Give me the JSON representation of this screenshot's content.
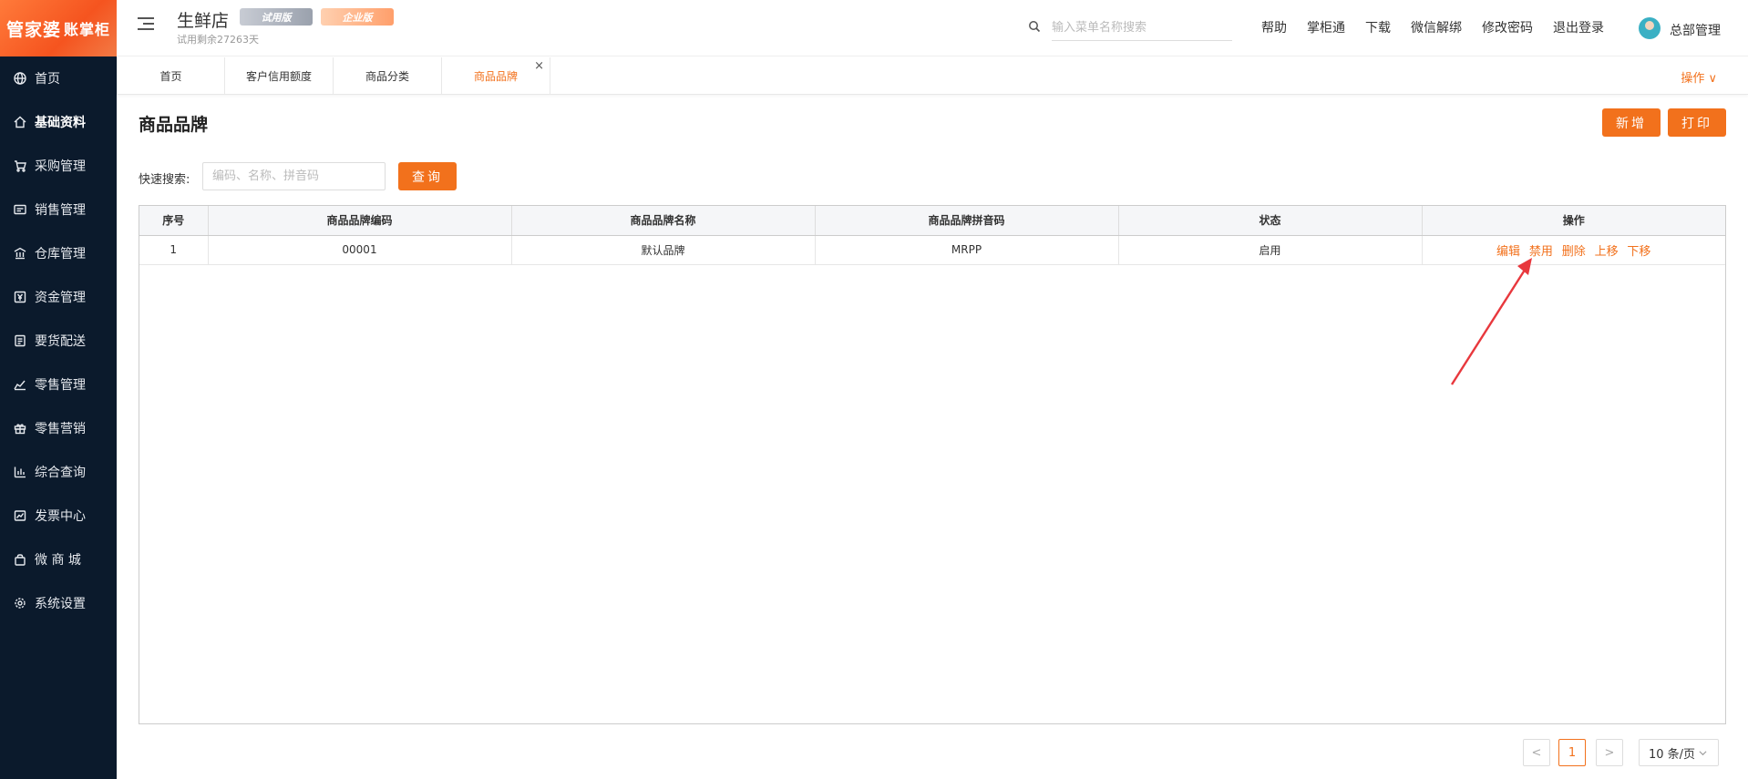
{
  "app": {
    "logo_text_1": "管家婆",
    "logo_text_2": "账掌柜",
    "store_name": "生鲜店",
    "badge_trial": "试用版",
    "badge_enterprise": "企业版",
    "trial_remaining": "试用剩余27263天"
  },
  "sidebar": {
    "items": [
      {
        "label": "首页",
        "icon": "globe-icon"
      },
      {
        "label": "基础资料",
        "icon": "home-icon"
      },
      {
        "label": "采购管理",
        "icon": "cart-icon"
      },
      {
        "label": "销售管理",
        "icon": "sales-icon"
      },
      {
        "label": "仓库管理",
        "icon": "warehouse-icon"
      },
      {
        "label": "资金管理",
        "icon": "finance-icon"
      },
      {
        "label": "要货配送",
        "icon": "delivery-icon"
      },
      {
        "label": "零售管理",
        "icon": "retail-icon"
      },
      {
        "label": "零售营销",
        "icon": "gift-icon"
      },
      {
        "label": "综合查询",
        "icon": "bar-chart-icon"
      },
      {
        "label": "发票中心",
        "icon": "invoice-icon"
      },
      {
        "label": "微 商 城",
        "icon": "shop-bag-icon"
      },
      {
        "label": "系统设置",
        "icon": "gear-icon"
      }
    ],
    "active_index": 1
  },
  "header": {
    "search_placeholder": "输入菜单名称搜索",
    "links": [
      "帮助",
      "掌柜通",
      "下载",
      "微信解绑",
      "修改密码",
      "退出登录"
    ],
    "user": "总部管理"
  },
  "tabs": {
    "items": [
      "首页",
      "客户信用额度",
      "商品分类",
      "商品品牌"
    ],
    "active": "商品品牌",
    "close_symbol": "×",
    "ops_label": "操作 ∨"
  },
  "page": {
    "title": "商品品牌",
    "new_button": "新增",
    "print_button": "打印",
    "quick_search_label": "快速搜索:",
    "quick_search_placeholder": "编码、名称、拼音码",
    "query_button": "查询"
  },
  "table": {
    "columns": [
      "序号",
      "商品品牌编码",
      "商品品牌名称",
      "商品品牌拼音码",
      "状态",
      "操作"
    ],
    "rows": [
      {
        "index": "1",
        "code": "00001",
        "name": "默认品牌",
        "pinyin": "MRPP",
        "status": "启用"
      }
    ],
    "row_actions": [
      "编辑",
      "禁用",
      "删除",
      "上移",
      "下移"
    ]
  },
  "pagination": {
    "prev": "<",
    "current_page": "1",
    "next": ">",
    "page_size": "10 条/页"
  },
  "colors": {
    "accent": "#f2711c",
    "sidebar_bg": "#0b1a2c"
  }
}
